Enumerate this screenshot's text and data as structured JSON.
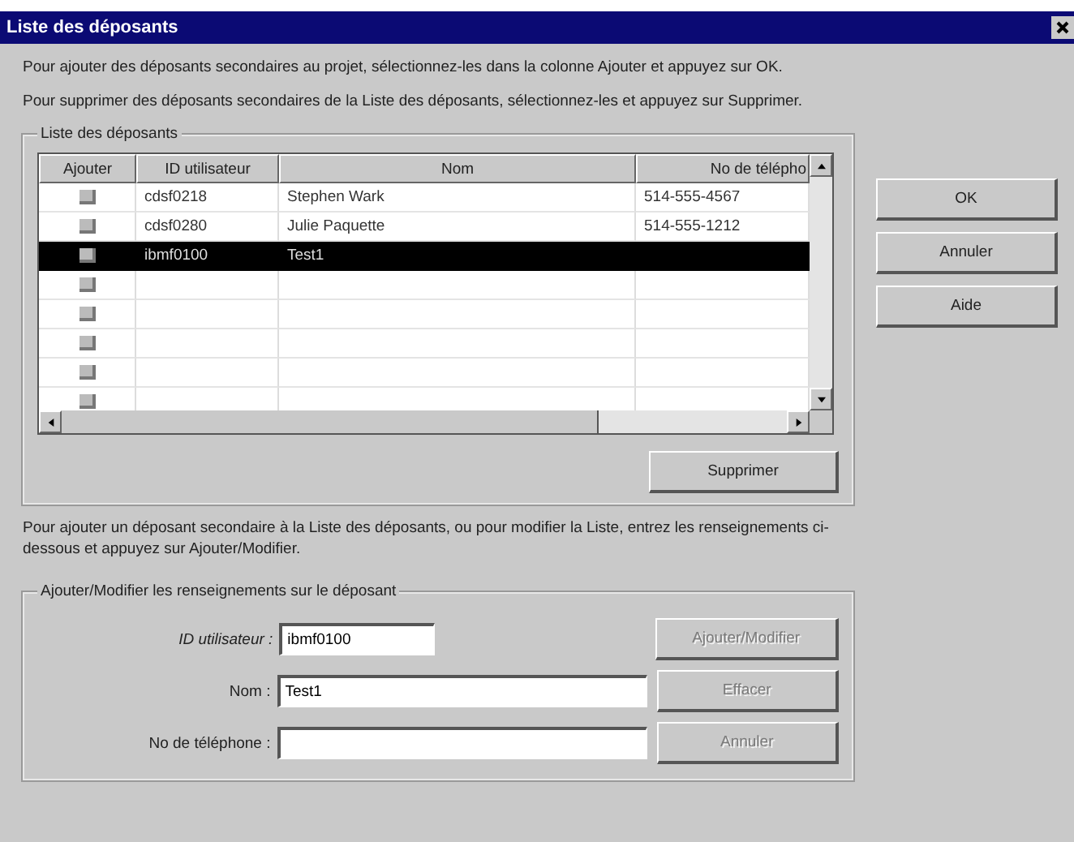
{
  "window": {
    "title": "Liste des déposants"
  },
  "instructions": [
    "Pour ajouter des déposants secondaires au projet, sélectionnez-les dans la colonne Ajouter et appuyez sur OK.",
    "Pour supprimer des déposants secondaires de la Liste des déposants, sélectionnez-les et appuyez sur Supprimer."
  ],
  "list_group": {
    "title": "Liste des déposants",
    "columns": [
      "Ajouter",
      "ID utilisateur",
      "Nom",
      "No de télépho"
    ],
    "rows": [
      {
        "checked": false,
        "selected": false,
        "id": "cdsf0218",
        "name": "Stephen Wark",
        "phone": "514-555-4567"
      },
      {
        "checked": false,
        "selected": false,
        "id": "cdsf0280",
        "name": "Julie Paquette",
        "phone": "514-555-1212"
      },
      {
        "checked": false,
        "selected": true,
        "id": "ibmf0100",
        "name": "Test1"
      },
      {
        "checked": false,
        "selected": false
      },
      {
        "checked": false,
        "selected": false
      },
      {
        "checked": false,
        "selected": false
      },
      {
        "checked": false,
        "selected": false
      },
      {
        "checked": false,
        "selected": false
      }
    ],
    "delete_button": {
      "label": "Supprimer",
      "disabled": false
    }
  },
  "side_buttons": [
    {
      "label": "OK",
      "disabled": false
    },
    {
      "label": "Annuler",
      "disabled": false
    },
    {
      "label": "Aide",
      "disabled": false
    }
  ],
  "edit_instruction": "Pour ajouter un déposant secondaire à la Liste des déposants, ou pour modifier la Liste, entrez les renseignements ci-dessous et appuyez sur Ajouter/Modifier.",
  "edit_group": {
    "title": "Ajouter/Modifier les renseignements sur le déposant",
    "fields": [
      {
        "kind": "short",
        "label": "ID utilisateur :",
        "italic": true,
        "value": "ibmf0100",
        "button": {
          "label": "Ajouter/Modifier",
          "disabled": true
        }
      },
      {
        "kind": "long",
        "label": "Nom :",
        "italic": false,
        "value": "Test1",
        "button": {
          "label": "Effacer",
          "disabled": true
        }
      },
      {
        "kind": "long",
        "label": "No de téléphone :",
        "italic": false,
        "button": {
          "label": "Annuler",
          "disabled": true
        }
      }
    ]
  }
}
